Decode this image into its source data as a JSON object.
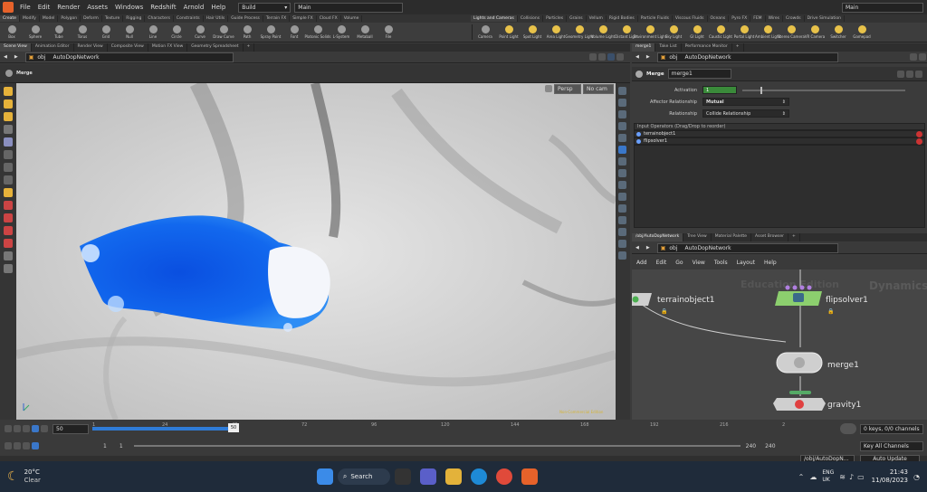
{
  "menu": [
    "File",
    "Edit",
    "Render",
    "Assets",
    "Windows",
    "Redshift",
    "Arnold",
    "Help"
  ],
  "build_label": "Build",
  "main_label": "Main",
  "right_main_label": "Main",
  "shelf_tabs_left": [
    "Create",
    "Modify",
    "Model",
    "Polygon",
    "Deform",
    "Texture",
    "Rigging",
    "Characters",
    "Constraints",
    "Hair Utils",
    "Guide Process",
    "Terrain FX",
    "Simple FX",
    "Cloud FX",
    "Volume"
  ],
  "shelf_tabs_right": [
    "Lights and Cameras",
    "Collisions",
    "Particles",
    "Grains",
    "Vellum",
    "Rigid Bodies",
    "Particle Fluids",
    "Viscous Fluids",
    "Oceans",
    "Pyro FX",
    "FEM",
    "Wires",
    "Crowds",
    "Drive Simulation"
  ],
  "tools_left": [
    "Box",
    "Sphere",
    "Tube",
    "Torus",
    "Grid",
    "Null",
    "Line",
    "Circle",
    "Curve",
    "Draw Curve",
    "Path",
    "Spray Paint",
    "Font",
    "Platonic Solids",
    "L-System",
    "Metaball",
    "File"
  ],
  "tools_right": [
    "Camera",
    "Point Light",
    "Spot Light",
    "Area Light",
    "Geometry Light",
    "Volume Light",
    "Distant Light",
    "Environment Light",
    "Sky Light",
    "GI Light",
    "Caustic Light",
    "Portal Light",
    "Ambient Light",
    "Stereo Camera",
    "VR Camera",
    "Switcher",
    "Gamepad"
  ],
  "left_pane_tabs": [
    "Scene View",
    "Animation Editor",
    "Render View",
    "Composite View",
    "Motion FX View",
    "Geometry Spreadsheet"
  ],
  "left_path": {
    "root": "obj",
    "network": "AutoDopNetwork"
  },
  "viewport_header": "Merge",
  "viewport_persp": "Persp",
  "viewport_cam": "No cam",
  "right_top_tabs": [
    "merge1",
    "Take List",
    "Performance Monitor"
  ],
  "right_path": {
    "root": "obj",
    "network": "AutoDopNetwork"
  },
  "params": {
    "node_type": "Merge",
    "node_name": "merge1",
    "activation_label": "Activation",
    "activation_value": "1",
    "affector_label": "Affector Relationship",
    "affector_value": "Mutual",
    "relationship_label": "Relationship",
    "relationship_value": "Collide Relationship",
    "list_header": "Input Operators (Drag/Drop to reorder)",
    "inputs": [
      "terrainobject1",
      "flipsolver1"
    ]
  },
  "network_tabs": [
    "/obj/AutoDopNetwork",
    "Tree View",
    "Material Palette",
    "Asset Browser"
  ],
  "network_path": {
    "root": "obj",
    "network": "AutoDopNetwork"
  },
  "network_menu": [
    "Add",
    "Edit",
    "Go",
    "View",
    "Tools",
    "Layout",
    "Help"
  ],
  "network_watermark": [
    "Education Edition",
    "Dynamics"
  ],
  "nodes": {
    "terrain": "terrainobject1",
    "flipsolver": "flipsolver1",
    "merge": "merge1",
    "gravity": "gravity1"
  },
  "timeline": {
    "frame_value": "50",
    "ticks": [
      "1",
      "24",
      "48",
      "72",
      "96",
      "120",
      "144",
      "168",
      "192",
      "216",
      "2"
    ],
    "current_frame": "50",
    "range_start": "1",
    "range_start2": "1",
    "range_end": "240",
    "range_end2": "240",
    "keys_label": "0 keys, 0/0 channels",
    "key_all": "Key All Channels",
    "auto_update": "Auto Update",
    "path_field": "/obj/AutoDopN..."
  },
  "taskbar": {
    "temp": "20°C",
    "weather": "Clear",
    "search": "Search",
    "lang1": "ENG",
    "lang2": "UK",
    "time": "21:43",
    "date": "11/08/2023"
  },
  "colors": {
    "accent": "#2f7bd6",
    "activation": "#3a8a3a",
    "flipsolver": "#8ccf6e",
    "gravity": "#55aa66",
    "node_connector": "#b07fe0"
  }
}
